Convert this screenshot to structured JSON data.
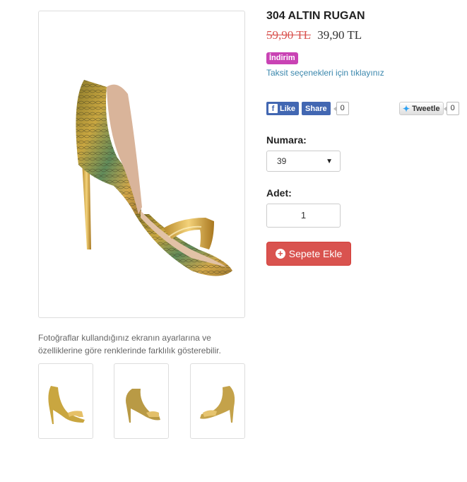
{
  "product": {
    "title": "304 ALTIN RUGAN",
    "old_price": "59,90 TL",
    "new_price": "39,90 TL",
    "discount_badge": "İndirim",
    "installment_link": "Taksit seçenekleri için tıklayınız",
    "photo_note": "Fotoğraflar kullandığınız ekranın ayarlarına ve özelliklerine göre renklerinde farklılık gösterebilir."
  },
  "social": {
    "fb_like_label": "Like",
    "fb_logo": "f",
    "fb_share_label": "Share",
    "fb_count": "0",
    "tweet_label": "Tweetle",
    "tweet_count": "0"
  },
  "size": {
    "label": "Numara:",
    "selected": "39",
    "caret": "▼"
  },
  "quantity": {
    "label": "Adet:",
    "value": "1"
  },
  "cart": {
    "button_label": "Sepete Ekle",
    "icon": "+"
  },
  "icons": {
    "facebook": "facebook-icon",
    "twitter": "twitter-bird-icon",
    "cart_plus": "plus-circle-icon"
  },
  "colors": {
    "cart_button": "#d9534f",
    "discount_badge": "#c943b4",
    "link": "#3a87ad",
    "facebook": "#4267b2",
    "old_price": "#d9534f"
  }
}
